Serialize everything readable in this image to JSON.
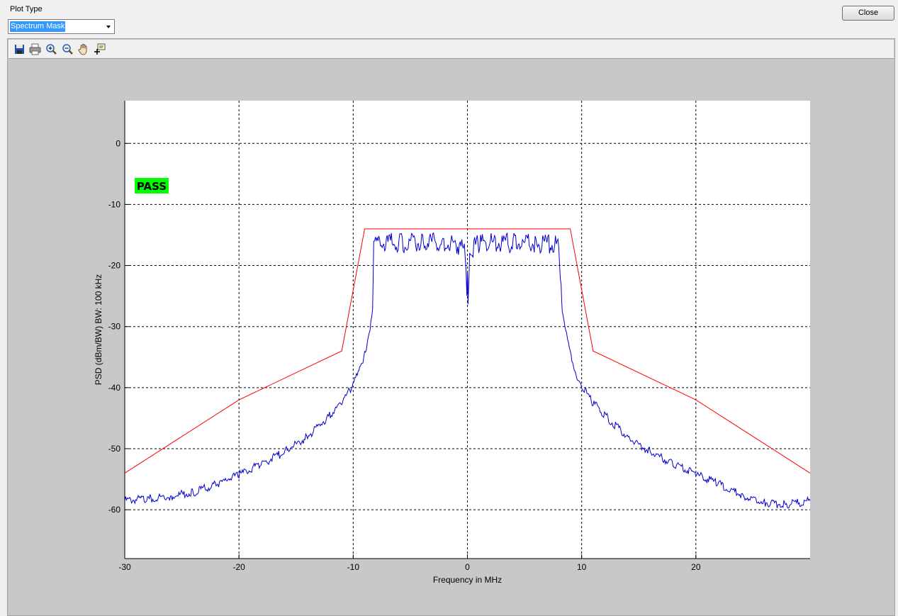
{
  "controls": {
    "plot_type_label": "Plot Type",
    "plot_type_value": "Spectrum Mask",
    "close_label": "Close"
  },
  "toolbar": {
    "tools": [
      "save-icon",
      "print-icon",
      "zoom-in-icon",
      "zoom-out-icon",
      "pan-hand-icon",
      "data-cursor-icon"
    ]
  },
  "badge": {
    "text": "PASS",
    "color": "#00ff00"
  },
  "chart_data": {
    "type": "line",
    "title": "",
    "xlabel": "Frequency in MHz",
    "ylabel": "PSD (dBm/BW) BW: 100 kHz",
    "xlim": [
      -30,
      30
    ],
    "ylim": [
      -68,
      7
    ],
    "xticks": [
      -30,
      -20,
      -10,
      0,
      10,
      20
    ],
    "yticks": [
      0,
      -10,
      -20,
      -30,
      -40,
      -50,
      -60
    ],
    "grid": true,
    "series": [
      {
        "role": "mask",
        "color": "#ff0000",
        "x": [
          -30,
          -20,
          -11,
          -9,
          9,
          11,
          20,
          30
        ],
        "y": [
          -54,
          -42,
          -34,
          -14,
          -14,
          -34,
          -42,
          -54
        ]
      },
      {
        "role": "spectrum",
        "color": "#0000cc",
        "x": [
          -30,
          -28,
          -26,
          -24,
          -22,
          -20,
          -18,
          -16,
          -14,
          -12,
          -11,
          -10,
          -9.5,
          -9,
          -8.6,
          -8.3,
          -8.2,
          -6,
          -4,
          -2,
          -1,
          -0.2,
          -0.05,
          0,
          0.05,
          0.2,
          1,
          2,
          4,
          6,
          8,
          8.2,
          8.3,
          8.6,
          9,
          9.5,
          10,
          11,
          12,
          14,
          16,
          18,
          20,
          22,
          24,
          26,
          28,
          30
        ],
        "y": [
          -58.5,
          -58.2,
          -57.8,
          -57.2,
          -55.8,
          -54.2,
          -52.5,
          -50.5,
          -48,
          -44.5,
          -42.5,
          -39.5,
          -37.5,
          -34.5,
          -31,
          -27,
          -16.2,
          -16.3,
          -16.2,
          -16.2,
          -16.5,
          -17.5,
          -25.5,
          -22,
          -25.5,
          -17.5,
          -16.4,
          -16.2,
          -16.3,
          -16.4,
          -16.5,
          -23,
          -28,
          -31,
          -34.5,
          -37.5,
          -39.8,
          -42.5,
          -44.5,
          -48,
          -50.5,
          -52.5,
          -54.2,
          -55.8,
          -57.6,
          -58.8,
          -59.2,
          -58.5
        ]
      }
    ]
  }
}
